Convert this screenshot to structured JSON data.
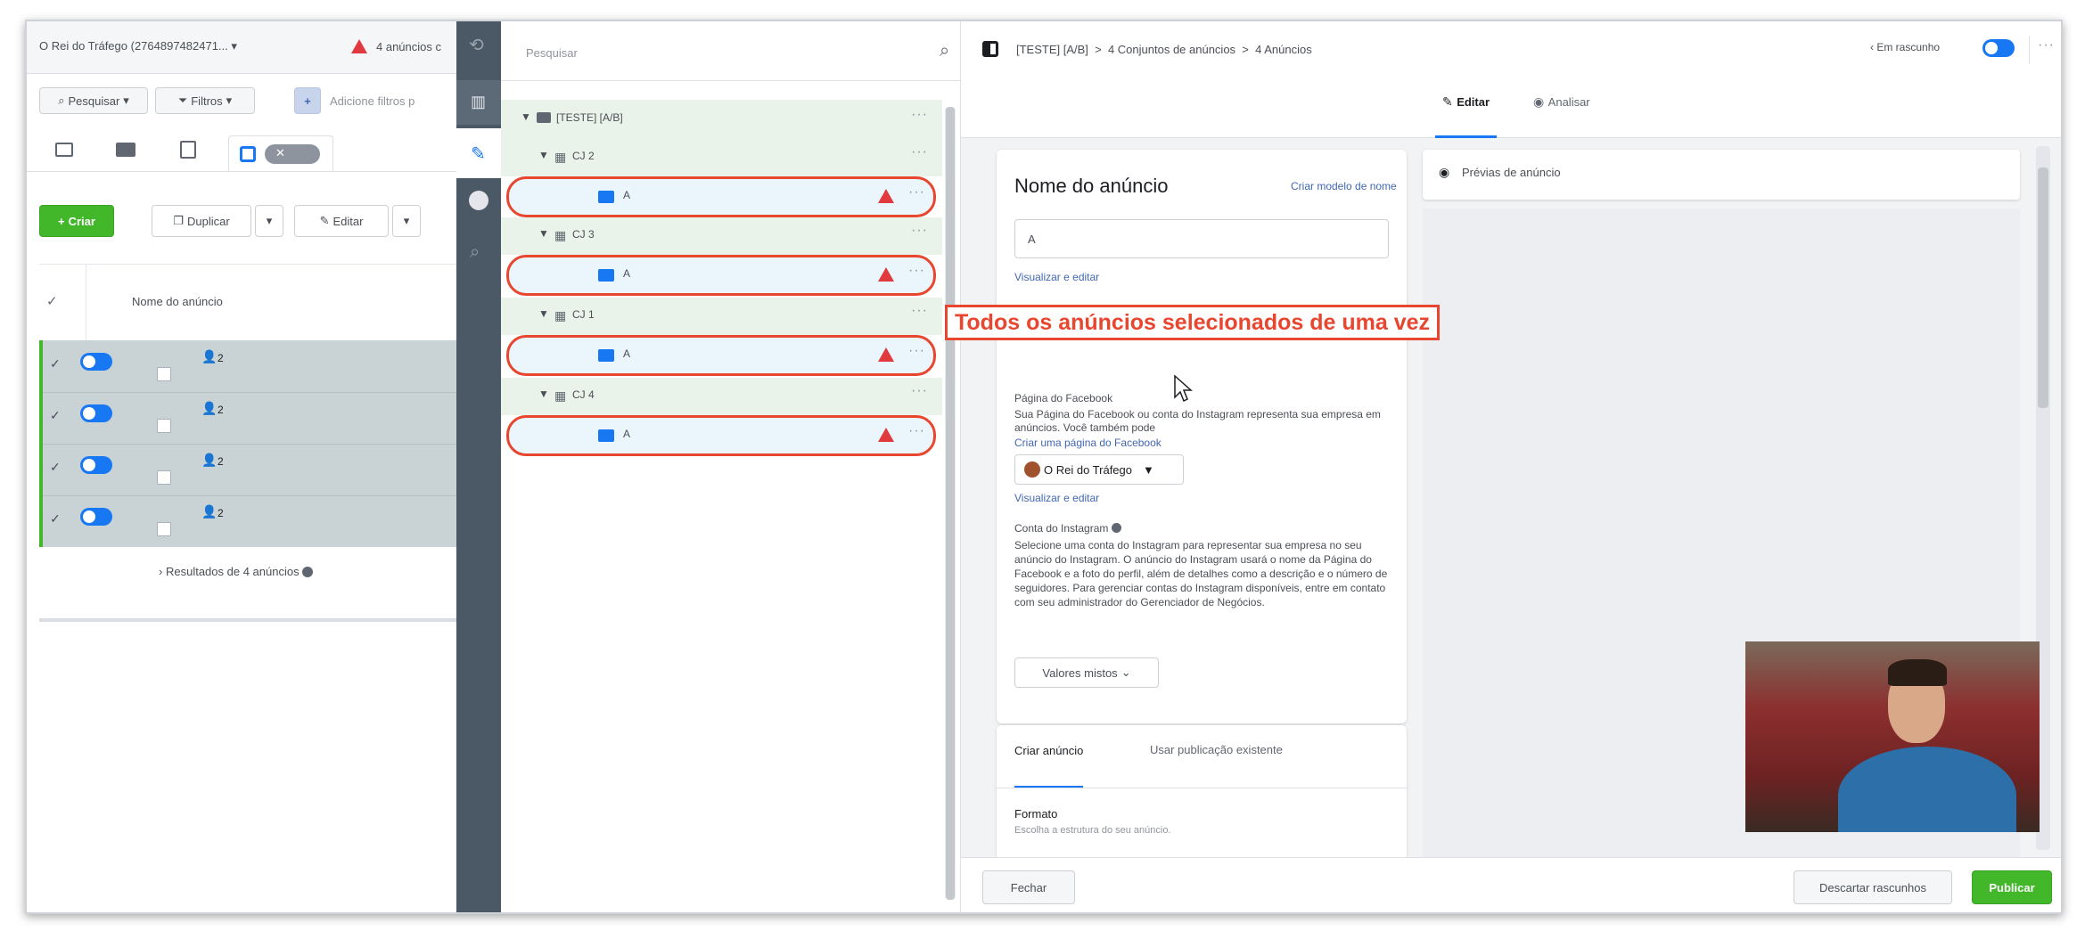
{
  "left": {
    "account_selector": "O Rei do Tráfego (2764897482471...",
    "alert_text": "4 anúncios c",
    "search_label": "Pesquisar",
    "filters_label": "Filtros",
    "add_filter_placeholder": "Adicione filtros p",
    "create_label": "Criar",
    "duplicate_label": "Duplicar",
    "edit_label": "Editar",
    "column_header": "Nome do anúncio",
    "rows": [
      {
        "label": "2"
      },
      {
        "label": "2"
      },
      {
        "label": "2"
      },
      {
        "label": "2"
      }
    ],
    "results": "Resultados de 4 anúncios"
  },
  "tree": {
    "search_placeholder": "Pesquisar",
    "campaign": "[TESTE] [A/B]",
    "groups": [
      {
        "label": "CJ 2",
        "ad": "A"
      },
      {
        "label": "CJ 3",
        "ad": "A"
      },
      {
        "label": "CJ 1",
        "ad": "A"
      },
      {
        "label": "CJ 4",
        "ad": "A"
      }
    ]
  },
  "editor": {
    "breadcrumb": "[TESTE] [A/B]  >  4 Conjuntos de anúncios  >  4 Anúncios",
    "draft_label": "Em rascunho",
    "tab_edit": "Editar",
    "tab_review": "Analisar",
    "ad_name_title": "Nome do anúncio",
    "create_template_link": "Criar modelo de nome",
    "ad_name_value": "A",
    "view_edit_link": "Visualizar e editar",
    "facebook_page_label": "Página do Facebook",
    "facebook_page_desc": "Sua Página do Facebook ou conta do Instagram representa sua empresa em anúncios. Você também pode",
    "create_page_link": "Criar uma página do Facebook",
    "page_selector": "O Rei do Tráfego",
    "view_edit_link2": "Visualizar e editar",
    "instagram_label": "Conta do Instagram",
    "instagram_desc": "Selecione uma conta do Instagram para representar sua empresa no seu anúncio do Instagram. O anúncio do Instagram usará o nome da Página do Facebook e a foto do perfil, além de detalhes como a descrição e o número de seguidores. Para gerenciar contas do Instagram disponíveis, entre em contato com seu administrador do Gerenciador de Negócios.",
    "mixed_values": "Valores mistos",
    "tab_create_ad": "Criar anúncio",
    "tab_existing_post": "Usar publicação existente",
    "format_label": "Formato",
    "format_desc": "Escolha a estrutura do seu anúncio.",
    "close_button": "Fechar",
    "discard_button": "Descartar rascunhos",
    "publish_button": "Publicar"
  },
  "preview": {
    "title": "Prévias de anúncio"
  },
  "annotation": {
    "text": "Todos os anúncios selecionados de uma vez"
  },
  "colors": {
    "accent": "#1877f2",
    "green": "#42b72a",
    "annotation_red": "#e8462f",
    "sidebar": "#4b5966"
  }
}
